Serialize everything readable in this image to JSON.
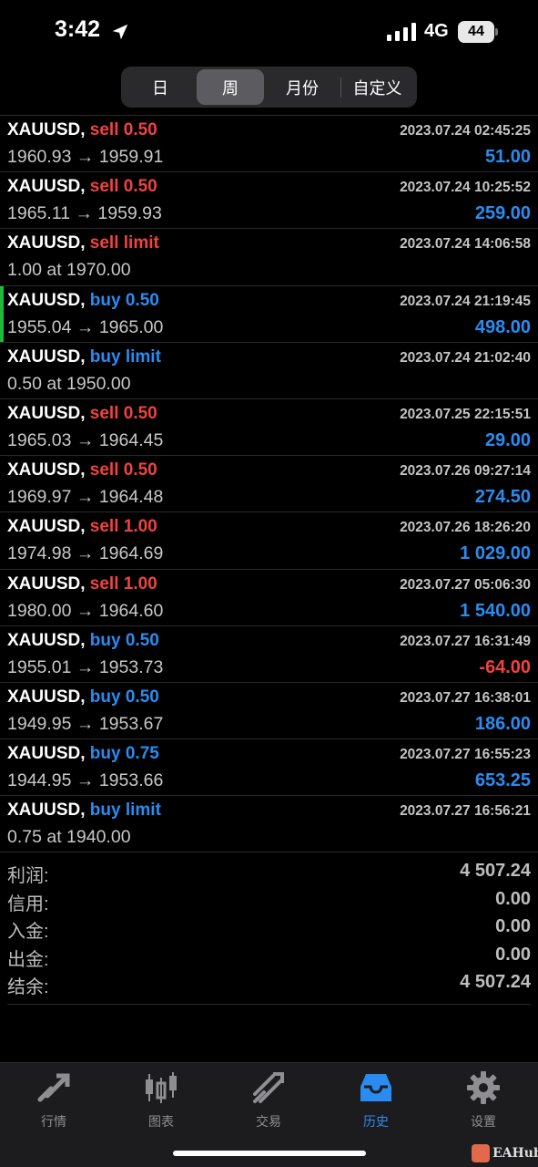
{
  "status_bar": {
    "time": "3:42",
    "network": "4G",
    "battery": "44"
  },
  "period_tabs": [
    {
      "label": "日",
      "selected": false
    },
    {
      "label": "周",
      "selected": true
    },
    {
      "label": "月份",
      "selected": false
    },
    {
      "label": "自定义",
      "selected": false
    }
  ],
  "trades": [
    {
      "symbol": "XAUUSD,",
      "action": "sell 0.50",
      "side": "sell",
      "time": "2023.07.24 02:45:25",
      "detail": "1960.93 → 1959.91",
      "profit": "51.00"
    },
    {
      "symbol": "XAUUSD,",
      "action": "sell 0.50",
      "side": "sell",
      "time": "2023.07.24 10:25:52",
      "detail": "1965.11 → 1959.93",
      "profit": "259.00"
    },
    {
      "symbol": "XAUUSD,",
      "action": "sell limit",
      "side": "sell",
      "time": "2023.07.24 14:06:58",
      "detail": "1.00 at 1970.00",
      "profit": ""
    },
    {
      "symbol": "XAUUSD,",
      "action": "buy 0.50",
      "side": "buy",
      "time": "2023.07.24 21:19:45",
      "detail": "1955.04 → 1965.00",
      "profit": "498.00"
    },
    {
      "symbol": "XAUUSD,",
      "action": "buy limit",
      "side": "buy",
      "time": "2023.07.24 21:02:40",
      "detail": "0.50 at 1950.00",
      "profit": ""
    },
    {
      "symbol": "XAUUSD,",
      "action": "sell 0.50",
      "side": "sell",
      "time": "2023.07.25 22:15:51",
      "detail": "1965.03 → 1964.45",
      "profit": "29.00"
    },
    {
      "symbol": "XAUUSD,",
      "action": "sell 0.50",
      "side": "sell",
      "time": "2023.07.26 09:27:14",
      "detail": "1969.97 → 1964.48",
      "profit": "274.50"
    },
    {
      "symbol": "XAUUSD,",
      "action": "sell 1.00",
      "side": "sell",
      "time": "2023.07.26 18:26:20",
      "detail": "1974.98 → 1964.69",
      "profit": "1 029.00"
    },
    {
      "symbol": "XAUUSD,",
      "action": "sell 1.00",
      "side": "sell",
      "time": "2023.07.27 05:06:30",
      "detail": "1980.00 → 1964.60",
      "profit": "1 540.00"
    },
    {
      "symbol": "XAUUSD,",
      "action": "buy 0.50",
      "side": "buy",
      "time": "2023.07.27 16:31:49",
      "detail": "1955.01 → 1953.73",
      "profit": "-64.00"
    },
    {
      "symbol": "XAUUSD,",
      "action": "buy 0.50",
      "side": "buy",
      "time": "2023.07.27 16:38:01",
      "detail": "1949.95 → 1953.67",
      "profit": "186.00"
    },
    {
      "symbol": "XAUUSD,",
      "action": "buy 0.75",
      "side": "buy",
      "time": "2023.07.27 16:55:23",
      "detail": "1944.95 → 1953.66",
      "profit": "653.25"
    },
    {
      "symbol": "XAUUSD,",
      "action": "buy limit",
      "side": "buy",
      "time": "2023.07.27 16:56:21",
      "detail": "0.75 at 1940.00",
      "profit": ""
    }
  ],
  "summary": [
    {
      "label": "利润:",
      "value": "4 507.24"
    },
    {
      "label": "信用:",
      "value": "0.00"
    },
    {
      "label": "入金:",
      "value": "0.00"
    },
    {
      "label": "出金:",
      "value": "0.00"
    },
    {
      "label": "结余:",
      "value": "4 507.24"
    }
  ],
  "tabbar": [
    {
      "label": "行情",
      "icon": "quotes-icon",
      "active": false
    },
    {
      "label": "图表",
      "icon": "chart-icon",
      "active": false
    },
    {
      "label": "交易",
      "icon": "trade-icon",
      "active": false
    },
    {
      "label": "历史",
      "icon": "history-icon",
      "active": true
    },
    {
      "label": "设置",
      "icon": "settings-icon",
      "active": false
    }
  ],
  "watermark": "EAHub",
  "colors": {
    "sell": "#f0433f",
    "buy": "#2a8cf0",
    "profit_positive": "#2a8cf0",
    "profit_negative": "#f0433f",
    "active_marker": "#1fba3a"
  }
}
